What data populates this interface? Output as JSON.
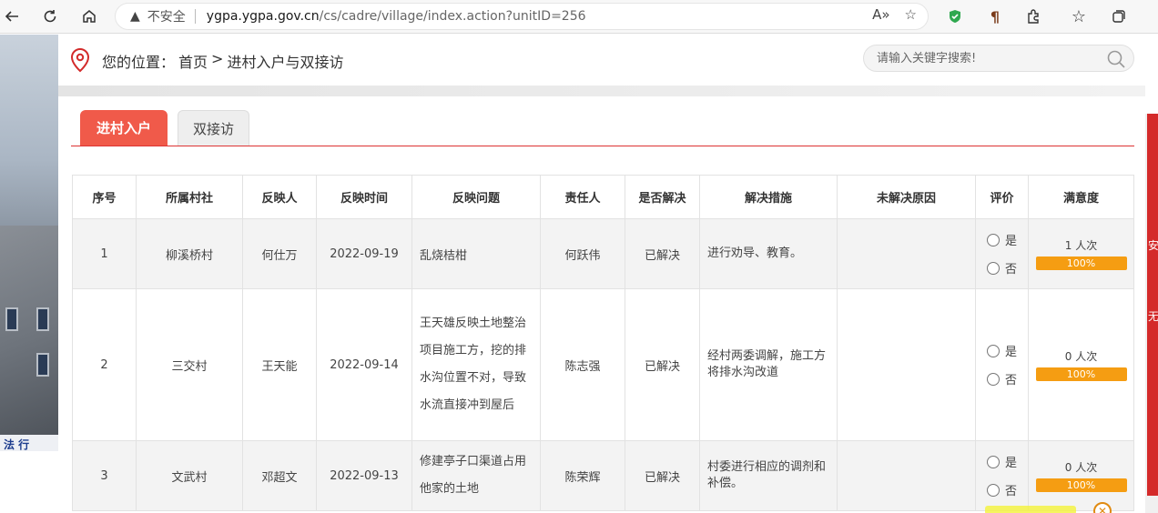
{
  "browser": {
    "insecure_label": "不安全",
    "url_host": "ygpa.ygpa.gov.cn",
    "url_path": "/cs/cadre/village/index.action?unitID=256"
  },
  "photo": {
    "plaque_text": "法 行"
  },
  "sidebar_right": {
    "chars": [
      "安",
      "无"
    ]
  },
  "breadcrumb": {
    "prefix": "您的位置：",
    "home": "首页",
    "separator": ">",
    "current": "进村入户与双接访"
  },
  "search": {
    "placeholder": "请输入关键字搜索!"
  },
  "tabs": [
    {
      "label": "进村入户"
    },
    {
      "label": "双接访"
    }
  ],
  "table": {
    "headers": [
      "序号",
      "所属村社",
      "反映人",
      "反映时间",
      "反映问题",
      "责任人",
      "是否解决",
      "解决措施",
      "未解决原因",
      "评价",
      "满意度"
    ],
    "rate_yes": "是",
    "rate_no": "否",
    "rows": [
      {
        "no": "1",
        "village": "柳溪桥村",
        "reporter": "何仕万",
        "date": "2022-09-19",
        "problem": "乱烧桔柑",
        "owner": "何跃伟",
        "solved": "已解决",
        "measure": "进行劝导、教育。",
        "reason": "",
        "count": "1 人次",
        "satisfaction": "100%",
        "satisfaction_value": 100
      },
      {
        "no": "2",
        "village": "三交村",
        "reporter": "王天能",
        "date": "2022-09-14",
        "problem": "王天雄反映土地整治项目施工方，挖的排水沟位置不对，导致水流直接冲到屋后",
        "owner": "陈志强",
        "solved": "已解决",
        "measure": "经村两委调解，施工方将排水沟改道",
        "reason": "",
        "count": "0 人次",
        "satisfaction": "100%",
        "satisfaction_value": 100
      },
      {
        "no": "3",
        "village": "文武村",
        "reporter": "邓超文",
        "date": "2022-09-13",
        "problem": "修建亭子口渠道占用他家的土地",
        "owner": "陈荣辉",
        "solved": "已解决",
        "measure": "村委进行相应的调剂和补偿。",
        "reason": "",
        "count": "0 人次",
        "satisfaction": "100%",
        "satisfaction_value": 100
      }
    ]
  }
}
